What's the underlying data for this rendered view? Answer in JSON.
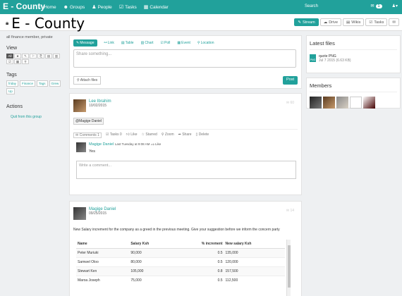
{
  "topbar": {
    "brand": "E - County",
    "nav": [
      {
        "label": "Home",
        "icon": "home-icon",
        "glyph": "⌂"
      },
      {
        "label": "Groups",
        "icon": "groups-icon",
        "glyph": "☻"
      },
      {
        "label": "People",
        "icon": "people-icon",
        "glyph": "♟"
      },
      {
        "label": "Tasks",
        "icon": "tasks-icon",
        "glyph": "☑"
      },
      {
        "label": "Calendar",
        "icon": "calendar-icon",
        "glyph": "▦"
      }
    ],
    "search_label": "Search",
    "notification_count": "1",
    "accent": "#21a19b"
  },
  "space": {
    "title": "E - County",
    "tabs": [
      {
        "label": "Stream",
        "icon": "stream-icon",
        "active": true
      },
      {
        "label": "Drive",
        "icon": "drive-icon"
      },
      {
        "label": "Wikis",
        "icon": "wikis-icon"
      },
      {
        "label": "Tasks",
        "icon": "tasks-icon"
      },
      {
        "label": "",
        "icon": "chat-icon"
      }
    ]
  },
  "left": {
    "membership": "all finance member, private",
    "view_heading": "View",
    "view_buttons": [
      "All",
      "★",
      "✎",
      "⚐",
      "⎘",
      "▤",
      "▥",
      "☑",
      "▦",
      "⚲"
    ],
    "tags_heading": "Tags",
    "tags": [
      "friday",
      "Finance",
      "Tags",
      "Grew",
      "Up"
    ],
    "actions_heading": "Actions",
    "quit_label": "Quit from this group"
  },
  "composer": {
    "tabs": [
      "Message",
      "Link",
      "Table",
      "Chart",
      "Poll",
      "Event",
      "Location"
    ],
    "placeholder": "Share something...",
    "attach_label": "Attach files",
    "post_label": "Post"
  },
  "post1": {
    "author": "Lee Ibrahim",
    "date": "10/02/2015",
    "comment_count": "60",
    "mention": "@Magige Daniel",
    "actions": [
      "Comments 1",
      "Tasks 0",
      "Like",
      "Starred",
      "Zoom",
      "Share",
      "Delete"
    ],
    "comment": {
      "author": "Magige Daniel",
      "time": "Last Tuesday at 9:08 AM",
      "like": "Like",
      "text": "Yes"
    },
    "comment_placeholder": "Write a comment..."
  },
  "post2": {
    "author": "Magige Daniel",
    "date": "09/25/2015",
    "comment_count": "14",
    "body": "New Salary increment for the company as a greed in the previous meeting. Give your suggestion before we inform the concern party",
    "table": {
      "headers": [
        "Name",
        "Salary Ksh",
        "% increment",
        "New salary Ksh"
      ],
      "rows": [
        [
          "Peter Muriuki",
          "90,000",
          "0.5",
          "135,000"
        ],
        [
          "Samwel Oloo",
          "80,000",
          "0.5",
          "120,000"
        ],
        [
          "Stewart Ken",
          "105,000",
          "0.8",
          "157,500"
        ],
        [
          "Maroa Joseph",
          "75,000",
          "0.5",
          "112,500"
        ]
      ]
    }
  },
  "right": {
    "files_title": "Latest files",
    "file_name": "quote PNG",
    "file_meta": "Jul 7 2015 (6.63 KB)",
    "members_title": "Members"
  }
}
